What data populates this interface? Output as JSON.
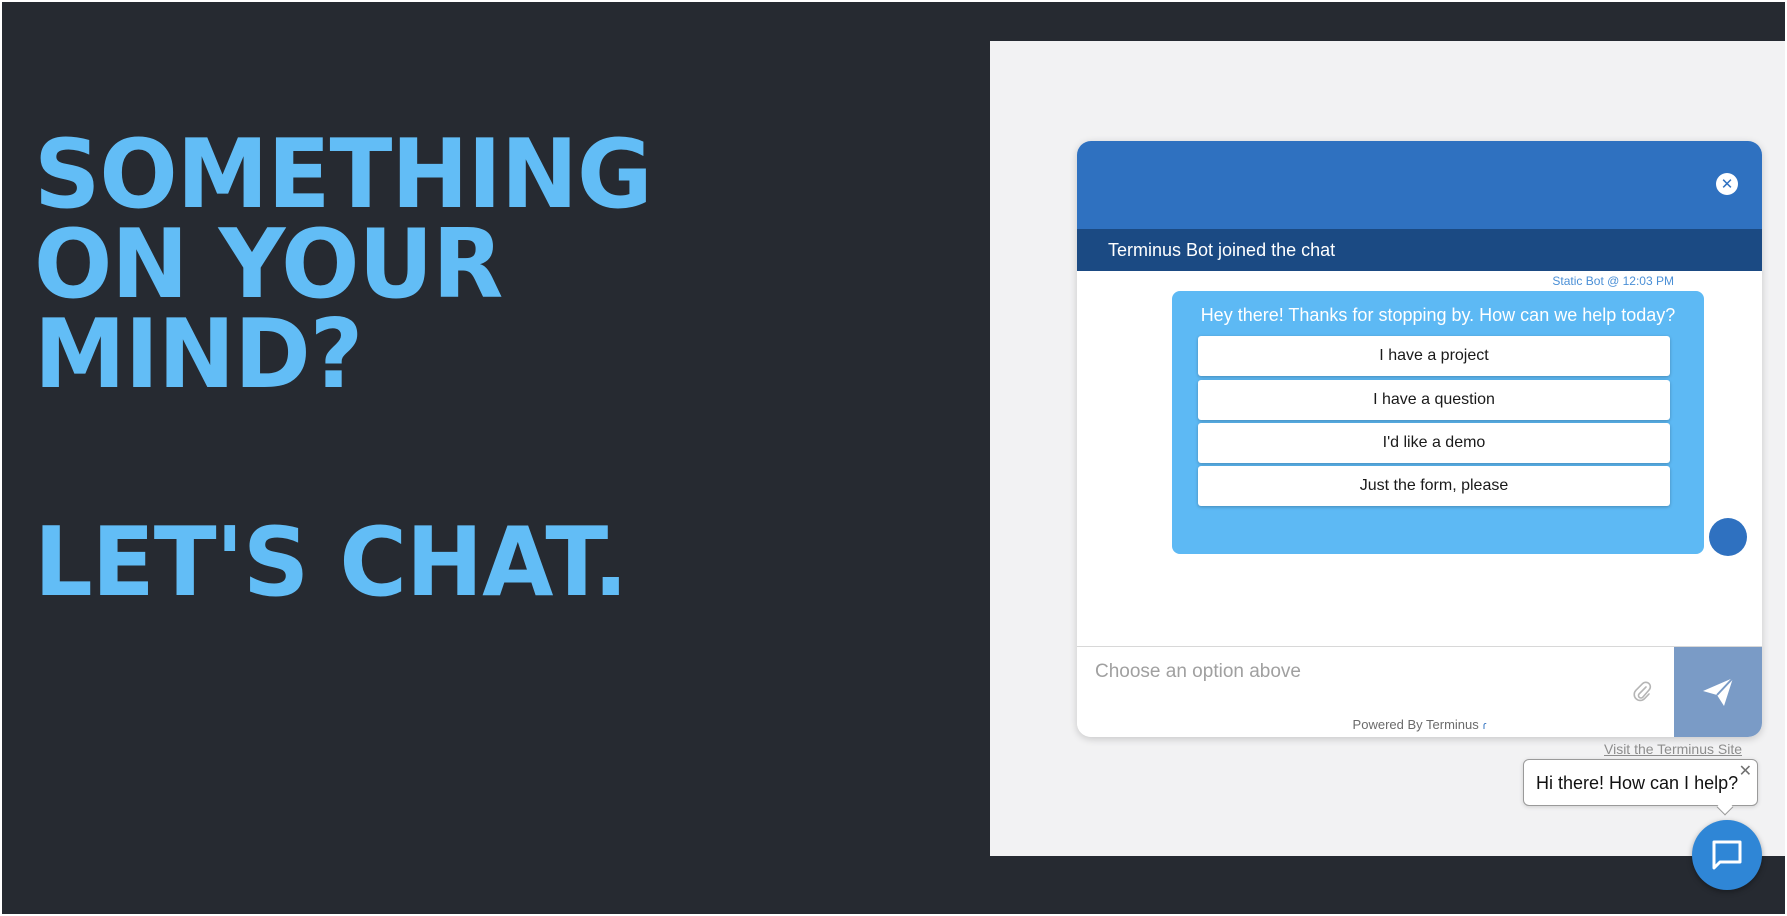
{
  "hero": {
    "line1": "SOMETHING",
    "line2": "ON YOUR",
    "line3": "MIND?",
    "cta": "LET'S CHAT."
  },
  "chat": {
    "close_icon": "close-circle-icon",
    "join_notice": "Terminus Bot joined the chat",
    "message_meta": "Static Bot @ 12:03 PM",
    "message_text": "Hey there! Thanks for stopping by. How can we help today?",
    "options": [
      "I have a project",
      "I have a question",
      "I'd like a demo",
      "Just the form, please"
    ],
    "composer_placeholder": "Choose an option above",
    "attach_icon": "paperclip-icon",
    "send_icon": "paper-plane-icon",
    "powered_by": "Powered By Terminus"
  },
  "visit_link": "Visit the Terminus Site",
  "greeting": {
    "text": "Hi there! How can I help?",
    "close_icon": "close-icon"
  },
  "launcher_icon": "chat-bubble-icon",
  "colors": {
    "page_bg": "#262a31",
    "hero_blue": "#62bdf6",
    "header_blue": "#2f71c0",
    "join_bar": "#1b4a83",
    "bubble": "#5db9f4",
    "send_button": "#7a9bc6"
  }
}
